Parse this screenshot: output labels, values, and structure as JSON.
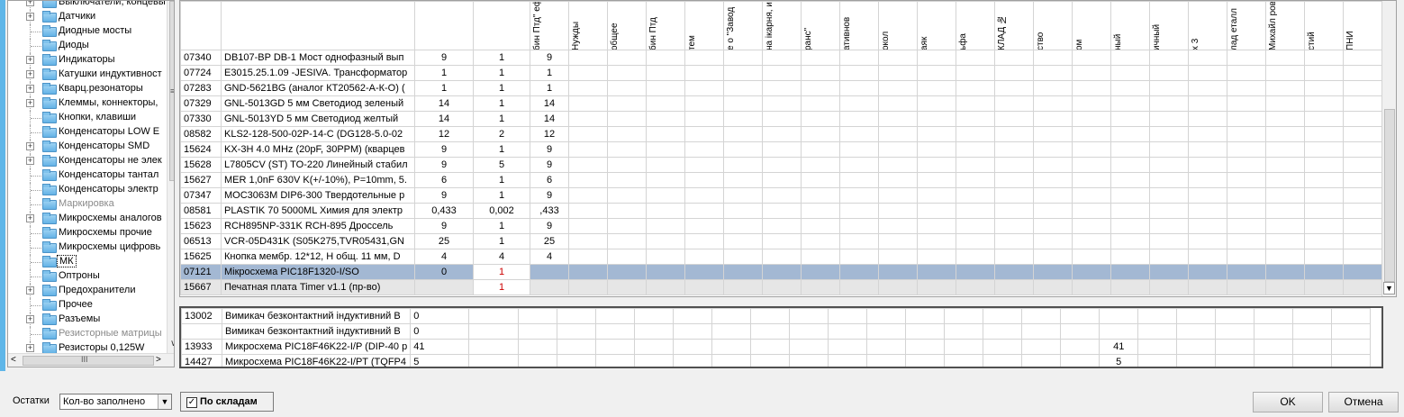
{
  "tree": {
    "items": [
      {
        "label": "Выключатели, концевы",
        "expand": true,
        "grey": false
      },
      {
        "label": "Датчики",
        "expand": true,
        "grey": false
      },
      {
        "label": "Диодные мосты",
        "expand": false,
        "grey": false
      },
      {
        "label": "Диоды",
        "expand": false,
        "grey": false
      },
      {
        "label": "Индикаторы",
        "expand": true,
        "grey": false
      },
      {
        "label": "Катушки индуктивност",
        "expand": true,
        "grey": false
      },
      {
        "label": "Кварц.резонаторы",
        "expand": true,
        "grey": false
      },
      {
        "label": "Клеммы, коннекторы,",
        "expand": true,
        "grey": false
      },
      {
        "label": "Кнопки, клавиши",
        "expand": false,
        "grey": false
      },
      {
        "label": "Конденсаторы LOW E",
        "expand": false,
        "grey": false
      },
      {
        "label": "Конденсаторы SMD",
        "expand": true,
        "grey": false
      },
      {
        "label": "Конденсаторы не элек",
        "expand": true,
        "grey": false
      },
      {
        "label": "Конденсаторы тантал",
        "expand": false,
        "grey": false
      },
      {
        "label": "Конденсаторы электр",
        "expand": false,
        "grey": false
      },
      {
        "label": "Маркировка",
        "expand": false,
        "grey": true
      },
      {
        "label": "Микросхемы аналогов",
        "expand": true,
        "grey": false
      },
      {
        "label": "Микросхемы прочие",
        "expand": false,
        "grey": false
      },
      {
        "label": "Микросхемы цифровь",
        "expand": false,
        "grey": false
      },
      {
        "label": "МК",
        "expand": false,
        "grey": false,
        "selected": true
      },
      {
        "label": "Оптроны",
        "expand": false,
        "grey": false
      },
      {
        "label": "Предохранители",
        "expand": true,
        "grey": false
      },
      {
        "label": "Прочее",
        "expand": false,
        "grey": false
      },
      {
        "label": "Разъемы",
        "expand": true,
        "grey": false
      },
      {
        "label": "Резисторные матрицы",
        "expand": false,
        "grey": true
      },
      {
        "label": "Резисторы 0,125W",
        "expand": true,
        "grey": false
      }
    ],
    "scroll_grip": "≡",
    "hscroll_grip": "III"
  },
  "grid": {
    "headers": [
      "",
      "",
      "",
      "",
      "бин Птд\" ефис",
      "Нужды",
      "общее",
      "бин Птд",
      "тем",
      "е о \"Завод",
      "на ікарня, инити",
      "ранс\"",
      "ативнов",
      "окол",
      "аяк",
      "ьфа",
      "КЛАД №",
      "ство",
      "ом",
      "ный",
      "ичный",
      "х 3",
      "лад еталл",
      "Михайл ровіч",
      "стий",
      "ПНИ"
    ],
    "rows": [
      {
        "code": "07340",
        "name": "DB107-BP DB-1 Мост однофазный вып",
        "qty": "9",
        "k": "1",
        "v": "9"
      },
      {
        "code": "07724",
        "name": "E3015.25.1.09 -JESIVA. Трансформатор",
        "qty": "1",
        "k": "1",
        "v": "1"
      },
      {
        "code": "07283",
        "name": "GND-5621BG (аналог КТ20562-А-К-О) (",
        "qty": "1",
        "k": "1",
        "v": "1"
      },
      {
        "code": "07329",
        "name": "GNL-5013GD 5 мм Светодиод зеленый",
        "qty": "14",
        "k": "1",
        "v": "14"
      },
      {
        "code": "07330",
        "name": "GNL-5013YD 5 мм Светодиод желтый",
        "qty": "14",
        "k": "1",
        "v": "14"
      },
      {
        "code": "08582",
        "name": "KLS2-128-500-02P-14-C (DG128-5.0-02",
        "qty": "12",
        "k": "2",
        "v": "12"
      },
      {
        "code": "15624",
        "name": "KX-3H 4.0 MHz (20pF, 30PPM) (кварцев",
        "qty": "9",
        "k": "1",
        "v": "9"
      },
      {
        "code": "15628",
        "name": "L7805CV (ST) TO-220 Линейный стабил",
        "qty": "9",
        "k": "5",
        "v": "9"
      },
      {
        "code": "15627",
        "name": "MER 1,0nF 630V K(+/-10%), P=10mm, 5.",
        "qty": "6",
        "k": "1",
        "v": "6"
      },
      {
        "code": "07347",
        "name": "MOC3063M DIP6-300 Твердотельные р",
        "qty": "9",
        "k": "1",
        "v": "9"
      },
      {
        "code": "08581",
        "name": "PLASTIK 70 5000ML  Химия для электр",
        "qty": "0,433",
        "k": "0,002",
        "v": ",433"
      },
      {
        "code": "15623",
        "name": "RCH895NP-331K RCH-895 Дроссель",
        "qty": "9",
        "k": "1",
        "v": "9"
      },
      {
        "code": "06513",
        "name": "VCR-05D431K (S05K275,TVR05431,GN",
        "qty": "25",
        "k": "1",
        "v": "25"
      },
      {
        "code": "15625",
        "name": "Кнопка мембр. 12*12, H общ. 11 мм, D",
        "qty": "4",
        "k": "4",
        "v": "4"
      },
      {
        "code": "07121",
        "name": "Мікросхема PIC18F1320-I/SO",
        "qty": "0",
        "k": "1",
        "v": "",
        "state": "sel"
      },
      {
        "code": "15667",
        "name": "Печатная плата Timer v1.1 (пр-во)",
        "qty": "",
        "k": "1",
        "v": "",
        "state": "cur"
      }
    ]
  },
  "grid2": {
    "rows": [
      {
        "code": "13002",
        "name": "Вимикач  безконтактний індуктивний В",
        "qty": "0",
        "extra": ""
      },
      {
        "code": "",
        "name": "Вимикач  безконтактний індуктивний В",
        "qty": "0",
        "extra": ""
      },
      {
        "code": "13933",
        "name": "Микросхема PIC18F46K22-I/P (DIP-40 р",
        "qty": "41",
        "extra": "41"
      },
      {
        "code": "14427",
        "name": "Микросхема PIC18F46K22-I/PT (TQFP4",
        "qty": "5",
        "extra": "5"
      }
    ]
  },
  "controls": {
    "ostatki_label": "Остатки",
    "ostatki_value": "Кол-во заполнено",
    "po_skladam_label": "По складам",
    "po_skladam_checked": "✓",
    "ok_label": "OK",
    "cancel_label": "Отмена"
  }
}
